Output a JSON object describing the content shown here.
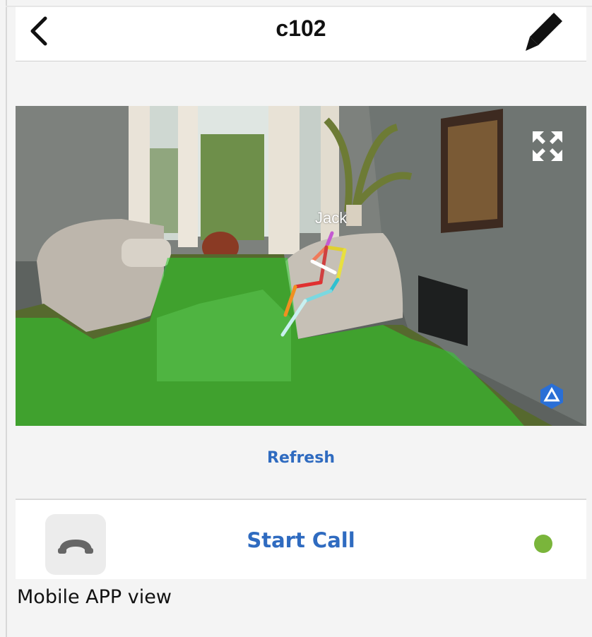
{
  "header": {
    "title": "c102",
    "back_icon": "chevron-left-icon",
    "edit_icon": "pencil-icon"
  },
  "camera": {
    "fullscreen_icon": "expand-arrows-icon",
    "person_label": "Jack",
    "overlay_color": "#2fcf2f",
    "logo_icon": "brand-logo-icon",
    "logo_color": "#2a6fd6"
  },
  "actions": {
    "refresh_label": "Refresh"
  },
  "call": {
    "phone_icon": "phone-hangup-icon",
    "start_call_label": "Start Call",
    "status_color": "#7ab53b"
  },
  "caption": "Mobile APP view",
  "colors": {
    "accent": "#2f6bc0",
    "background": "#f4f4f4"
  }
}
